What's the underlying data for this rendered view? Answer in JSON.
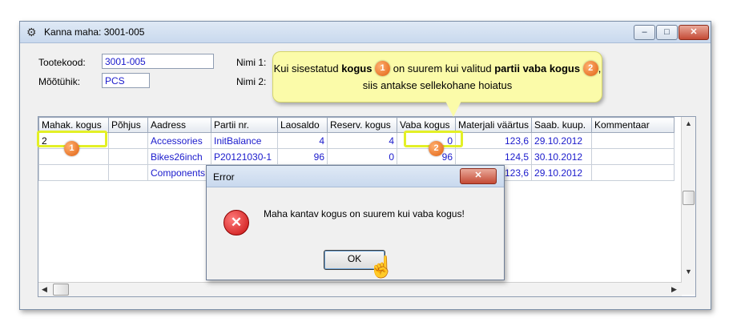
{
  "window": {
    "title": "Kanna maha: 3001-005",
    "min_glyph": "–",
    "max_glyph": "□",
    "close_glyph": "✕"
  },
  "form": {
    "code_label": "Tootekood:",
    "code_value": "3001-005",
    "unit_label": "Mõõtühik:",
    "unit_value": "PCS",
    "name1_label": "Nimi 1:",
    "name2_label": "Nimi 2:"
  },
  "callout": {
    "p1": "Kui sisestatud ",
    "b1": "kogus",
    "p2": " on suurem kui valitud ",
    "b2": "partii vaba kogus",
    "p3": ", siis antakse sellekohane hoiatus"
  },
  "badges": {
    "one": "1",
    "two": "2"
  },
  "table": {
    "columns": [
      "Mahak. kogus",
      "Põhjus",
      "Aadress",
      "Partii nr.",
      "Laosaldo",
      "Reserv. kogus",
      "Vaba kogus",
      "Materjali väärtus",
      "Saab. kuup.",
      "Kommentaar"
    ],
    "rows": [
      [
        "2",
        "",
        "Accessories",
        "InitBalance",
        "4",
        "4",
        "0",
        "123,6",
        "29.10.2012",
        ""
      ],
      [
        "",
        "",
        "Bikes26inch",
        "P20121030-1",
        "96",
        "0",
        "96",
        "124,5",
        "30.10.2012",
        ""
      ],
      [
        "",
        "",
        "Components",
        "",
        "",
        "",
        "",
        "123,6",
        "29.10.2012",
        ""
      ]
    ]
  },
  "dialog": {
    "title": "Error",
    "message": "Maha kantav kogus on suurem kui vaba kogus!",
    "ok_label": "OK",
    "close_glyph": "✕",
    "icon_glyph": "✕"
  },
  "scroll": {
    "up": "▲",
    "down": "▼",
    "left": "◀",
    "right": "▶"
  },
  "cursor_glyph": "☝",
  "colors": {
    "value_text": "#1a1acc",
    "highlight": "#e3f026",
    "badge": "#e06010",
    "callout_bg": "#fbfba9"
  }
}
